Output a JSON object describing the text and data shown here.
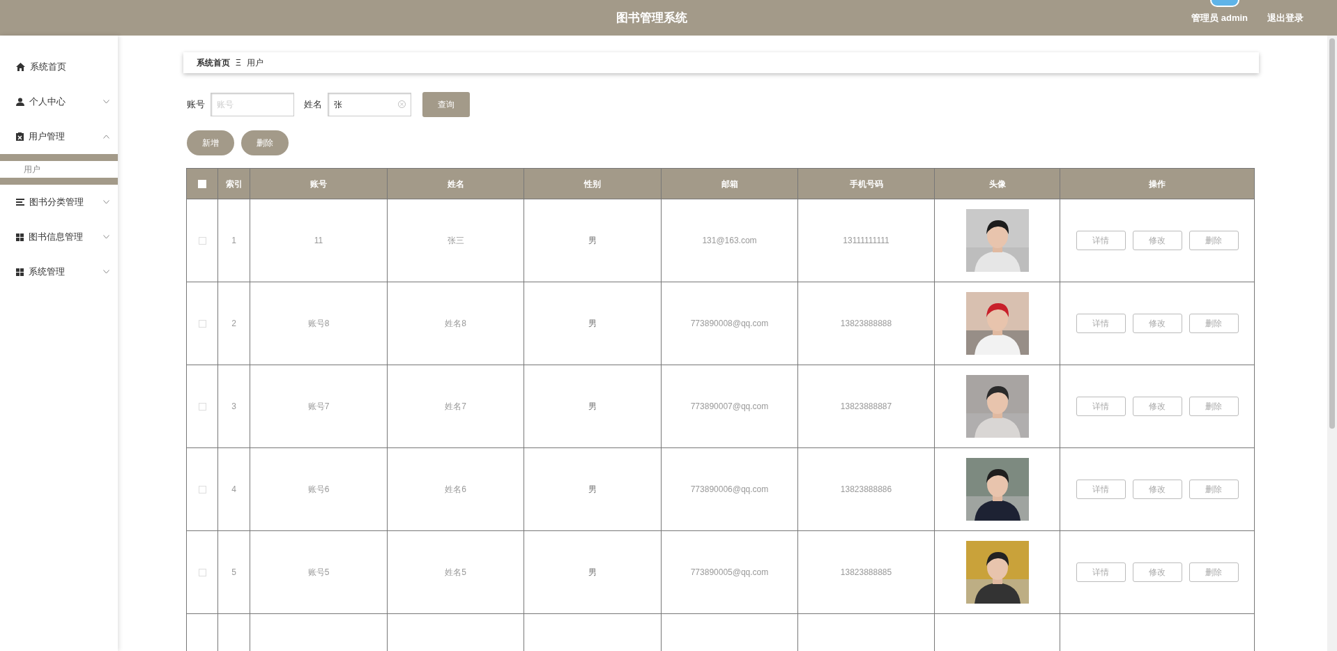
{
  "header": {
    "title": "图书管理系统",
    "user": "管理员 admin",
    "logout": "退出登录"
  },
  "sidebar": {
    "items": [
      {
        "label": "系统首页",
        "kind": "home"
      },
      {
        "label": "个人中心",
        "kind": "person",
        "expanded": false
      },
      {
        "label": "用户管理",
        "kind": "clipboard",
        "expanded": true,
        "children": [
          {
            "label": "用户",
            "selected": true
          }
        ]
      },
      {
        "label": "图书分类管理",
        "kind": "list",
        "expanded": false
      },
      {
        "label": "图书信息管理",
        "kind": "grid",
        "expanded": false
      },
      {
        "label": "系统管理",
        "kind": "grid",
        "expanded": false
      }
    ]
  },
  "breadcrumb": {
    "items": [
      "系统首页",
      "用户"
    ],
    "separator": "Ξ"
  },
  "search": {
    "fields": [
      {
        "label": "账号",
        "placeholder": "账号"
      },
      {
        "label": "姓名",
        "value": "张"
      }
    ],
    "button": "查询"
  },
  "actions": [
    "新增",
    "删除"
  ],
  "table": {
    "columns": [
      "索引",
      "账号",
      "姓名",
      "性别",
      "邮箱",
      "手机号码",
      "头像",
      "操作"
    ],
    "header_checked": false,
    "rows": [
      {
        "checked": false,
        "cells": [
          "1",
          "11",
          "张三",
          "男",
          "131@163.com",
          "13111111111"
        ],
        "buttons": [
          "详情",
          "修改",
          "删除"
        ]
      },
      {
        "checked": false,
        "cells": [
          "2",
          "账号8",
          "姓名8",
          "男",
          "773890008@qq.com",
          "13823888888"
        ],
        "buttons": [
          "详情",
          "修改",
          "删除"
        ]
      },
      {
        "checked": false,
        "cells": [
          "3",
          "账号7",
          "姓名7",
          "男",
          "773890007@qq.com",
          "13823888887"
        ],
        "buttons": [
          "详情",
          "修改",
          "删除"
        ]
      },
      {
        "checked": false,
        "cells": [
          "4",
          "账号6",
          "姓名6",
          "男",
          "773890006@qq.com",
          "13823888886"
        ],
        "buttons": [
          "详情",
          "修改",
          "删除"
        ]
      },
      {
        "checked": false,
        "cells": [
          "5",
          "账号5",
          "姓名5",
          "男",
          "773890005@qq.com",
          "13823888885"
        ],
        "buttons": [
          "详情",
          "修改",
          "删除"
        ]
      }
    ]
  }
}
